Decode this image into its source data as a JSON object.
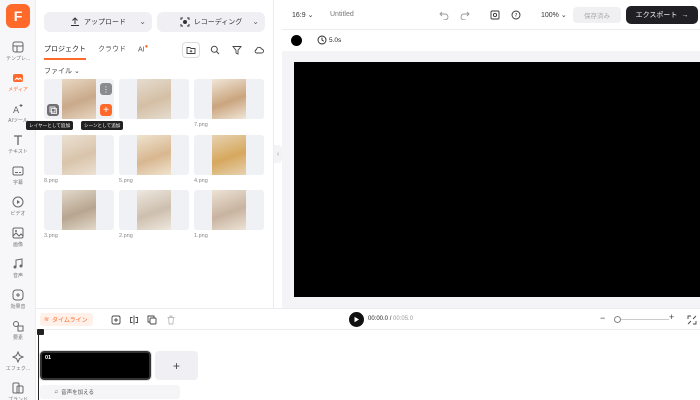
{
  "logo": "F",
  "rail": [
    {
      "label": "テンプレ...",
      "icon": "template-icon"
    },
    {
      "label": "メディア",
      "icon": "media-icon",
      "active": true
    },
    {
      "label": "AIツール",
      "icon": "ai-icon"
    },
    {
      "label": "テキスト",
      "icon": "text-icon"
    },
    {
      "label": "字幕",
      "icon": "subtitle-icon"
    },
    {
      "label": "ビデオ",
      "icon": "video-icon"
    },
    {
      "label": "画像",
      "icon": "image-icon"
    },
    {
      "label": "音声",
      "icon": "music-icon"
    },
    {
      "label": "効果音",
      "icon": "sfx-icon"
    },
    {
      "label": "要素",
      "icon": "elements-icon"
    },
    {
      "label": "エフェク...",
      "icon": "effects-icon"
    },
    {
      "label": "ブランド",
      "icon": "brand-icon"
    }
  ],
  "panel": {
    "upload_label": "アップロード",
    "record_label": "レコーディング",
    "tabs": [
      "プロジェクト",
      "クラウド",
      "AI"
    ],
    "folder_label": "ファイル",
    "tooltip_layer": "レイヤーとして追加",
    "tooltip_scene": "シーンとして追加",
    "files": [
      "",
      "",
      "7.png",
      "8.png",
      "5.png",
      "4.png",
      "3.png",
      "2.png",
      "1.png"
    ]
  },
  "topbar": {
    "aspect": "16:9",
    "title": "Untitled",
    "zoom": "100%",
    "save_label": "保存済み",
    "export_label": "エクスポート"
  },
  "canvas": {
    "duration": "5.0s",
    "bg_color": "#000000"
  },
  "timeline": {
    "label": "タイムライン",
    "current_time": "00:00.0",
    "total_time": "00:05.0",
    "clip_number": "01",
    "audio_label": "音声を加える"
  },
  "colors": {
    "accent": "#ff6a2a",
    "export_bg": "#1f1f24"
  }
}
